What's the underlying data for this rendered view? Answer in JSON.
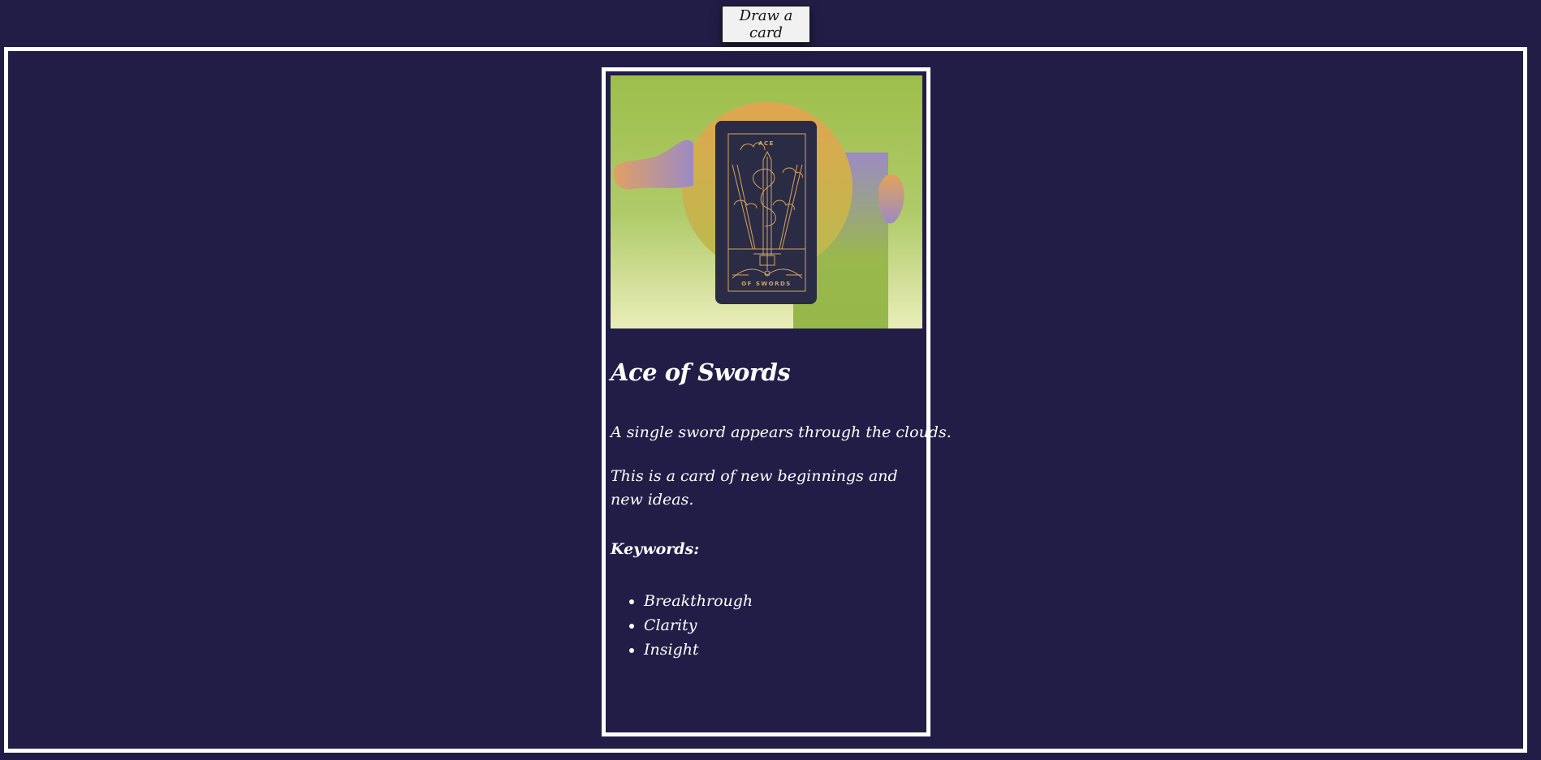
{
  "draw_button": {
    "label": "Draw a card"
  },
  "card": {
    "image": {
      "icon": "ace-of-swords-tarot-illustration",
      "top_text": "ACE",
      "bottom_text": "OF SWORDS",
      "colors": {
        "background_top": "#9dbe4b",
        "background_bottom": "#eaedb9",
        "circle": "#dca850",
        "card_body": "#2a2b45",
        "line_art": "#d8a45a",
        "purple_shape": "#9b8bc4"
      }
    },
    "title": "Ace of Swords",
    "descriptions": [
      "A single sword appears through the clouds.",
      "This is a card of new beginnings and new ideas."
    ],
    "keywords_heading": "Keywords:",
    "keywords": [
      "Breakthrough",
      "Clarity",
      "Insight"
    ]
  },
  "colors": {
    "page_background": "#221d47",
    "frame_border": "#ffffff",
    "text": "#ffffff",
    "button_background": "#f1f1f1"
  }
}
